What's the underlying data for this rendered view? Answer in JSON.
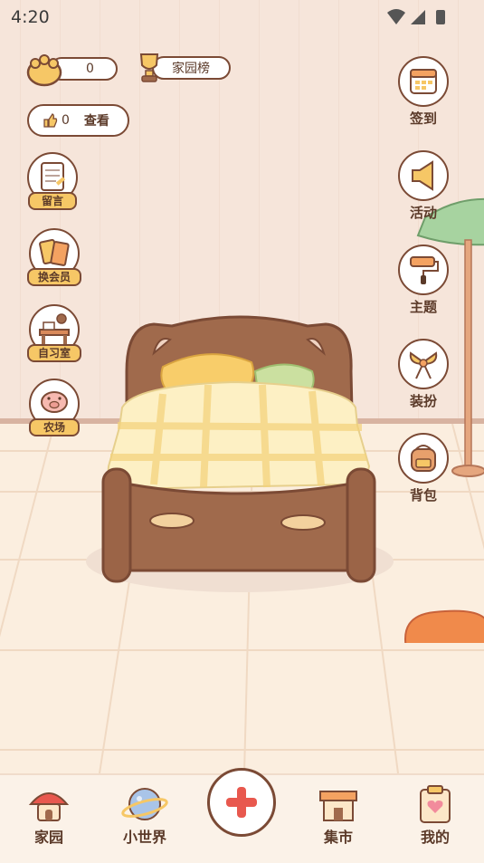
{
  "status_bar": {
    "time": "4:20"
  },
  "top": {
    "coins_value": "0",
    "ranking_label": "家园榜",
    "likes_value": "0",
    "view_label": "查看"
  },
  "left_menu": [
    {
      "label": "留言",
      "icon": "notepad-icon"
    },
    {
      "label": "换会员",
      "icon": "membership-card-icon"
    },
    {
      "label": "自习室",
      "icon": "study-desk-icon"
    },
    {
      "label": "农场",
      "icon": "farm-pig-icon"
    }
  ],
  "right_menu": [
    {
      "label": "签到",
      "icon": "calendar-icon"
    },
    {
      "label": "活动",
      "icon": "megaphone-icon"
    },
    {
      "label": "主题",
      "icon": "paint-roller-icon"
    },
    {
      "label": "装扮",
      "icon": "lollipop-bow-icon"
    },
    {
      "label": "背包",
      "icon": "backpack-icon"
    }
  ],
  "bottom_nav": [
    {
      "label": "家园",
      "icon": "mushroom-house-icon"
    },
    {
      "label": "小世界",
      "icon": "planet-icon"
    },
    {
      "label": "",
      "icon": "add-icon"
    },
    {
      "label": "集市",
      "icon": "market-stall-icon"
    },
    {
      "label": "我的",
      "icon": "clipboard-heart-icon"
    }
  ],
  "colors": {
    "accent_outline": "#7b4a35",
    "tag_yellow": "#f6c766",
    "add_red": "#e8584e",
    "wall": "#f6e5da",
    "floor": "#fbeedf"
  }
}
